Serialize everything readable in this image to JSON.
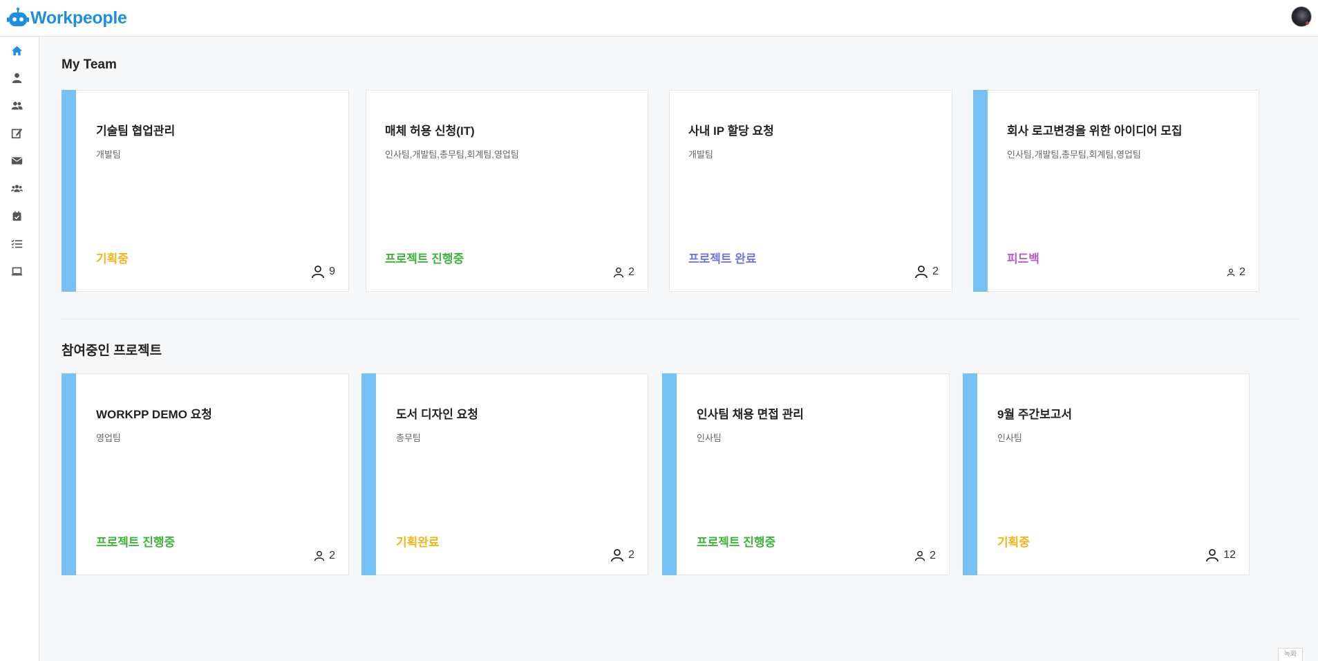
{
  "app": {
    "name": "Workpeople",
    "brand_color": "#1e8fe0"
  },
  "sidebar": {
    "items": [
      {
        "name": "home-icon",
        "active": true
      },
      {
        "name": "user-icon"
      },
      {
        "name": "users-icon"
      },
      {
        "name": "edit-icon"
      },
      {
        "name": "envelope-icon"
      },
      {
        "name": "user-group-icon"
      },
      {
        "name": "calendar-check-icon"
      },
      {
        "name": "task-list-icon"
      },
      {
        "name": "laptop-icon"
      }
    ]
  },
  "sections": {
    "my_team": {
      "title": "My Team",
      "cards": [
        {
          "title": "기술팀 협업관리",
          "teams": "개발팀",
          "status": "기획중",
          "status_color": "#f2b518",
          "members": "9"
        },
        {
          "title": "매체 허용 신청(IT)",
          "teams": "인사팀,개발팀,총무팀,회계팀,영업팀",
          "status": "프로젝트 진행중",
          "status_color": "#3cb43c",
          "members": "2"
        },
        {
          "title": "사내 IP 할당 요청",
          "teams": "개발팀",
          "status": "프로젝트 완료",
          "status_color": "#6f77e6",
          "members": "2"
        },
        {
          "title": "회사 로고변경을 위한 아이디어 모집",
          "teams": "인사팀,개발팀,총무팀,회계팀,영업팀",
          "status": "피드백",
          "status_color": "#b65cd0",
          "members": "2"
        }
      ]
    },
    "projects": {
      "title": "참여중인 프로젝트",
      "cards": [
        {
          "title": "WORKPP DEMO 요청",
          "teams": "영업팀",
          "status": "프로젝트 진행중",
          "status_color": "#3cb43c",
          "members": "2"
        },
        {
          "title": "도서 디자인 요청",
          "teams": "총무팀",
          "status": "기획완료",
          "status_color": "#f2b518",
          "members": "2"
        },
        {
          "title": "인사팀 채용 면접 관리",
          "teams": "인사팀",
          "status": "프로젝트 진행중",
          "status_color": "#3cb43c",
          "members": "2"
        },
        {
          "title": "9월 주간보고서",
          "teams": "인사팀",
          "status": "기획중",
          "status_color": "#f2b518",
          "members": "12"
        }
      ]
    }
  },
  "corner_button": {
    "label": "녹화"
  },
  "colors": {
    "card_accent": "#76c0f4",
    "background": "#f5f7f8"
  }
}
